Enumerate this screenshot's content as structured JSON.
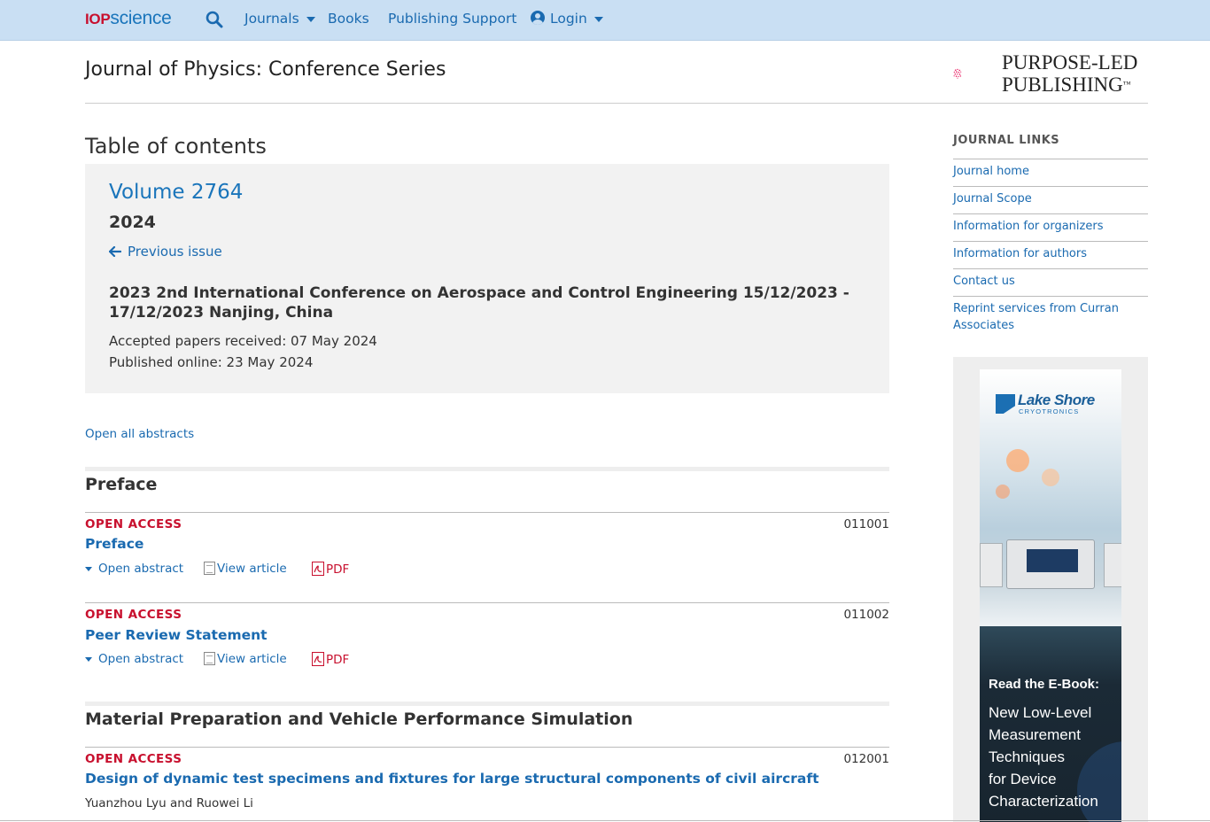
{
  "nav": {
    "logo_brand": "IOP",
    "logo_product": "science",
    "journals": "Journals",
    "books": "Books",
    "publishing_support": "Publishing Support",
    "login": "Login"
  },
  "header": {
    "journal_title": "Journal of Physics: Conference Series",
    "publisher_logo_line1": "PURPOSE-LED",
    "publisher_logo_line2": "PUBLISHING",
    "publisher_logo_tm": "™"
  },
  "toc": {
    "heading": "Table of contents",
    "volume": "Volume 2764",
    "year": "2024",
    "previous_issue": "Previous issue",
    "conference": "2023 2nd International Conference on Aerospace and Control Engineering 15/12/2023 - 17/12/2023 Nanjing, China",
    "accepted": "Accepted papers received: 07 May 2024",
    "published": "Published online: 23 May 2024",
    "open_all": "Open all abstracts"
  },
  "sections": [
    {
      "title": "Preface",
      "articles": [
        {
          "access": "OPEN ACCESS",
          "number": "011001",
          "title": "Preface",
          "open_abstract": "Open abstract",
          "view_article": "View article",
          "pdf": "PDF"
        },
        {
          "access": "OPEN ACCESS",
          "number": "011002",
          "title": "Peer Review Statement",
          "open_abstract": "Open abstract",
          "view_article": "View article",
          "pdf": "PDF"
        }
      ]
    },
    {
      "title": "Material Preparation and Vehicle Performance Simulation",
      "articles": [
        {
          "access": "OPEN ACCESS",
          "number": "012001",
          "title": "Design of dynamic test specimens and fixtures for large structural components of civil aircraft",
          "authors": "Yuanzhou Lyu and Ruowei Li"
        }
      ]
    }
  ],
  "sidebar": {
    "heading": "JOURNAL LINKS",
    "links": [
      "Journal home",
      "Journal Scope",
      "Information for organizers",
      "Information for authors",
      "Contact us",
      "Reprint services from Curran Associates"
    ]
  },
  "ad": {
    "brand": "Lake Shore",
    "brand_sub": "CRYOTRONICS",
    "cta": "Read the E-Book:",
    "lines": [
      "New Low-Level",
      "Measurement",
      "Techniques",
      "for Device",
      "Characterization"
    ]
  },
  "colors": {
    "nav_bg": "#c9dff3",
    "link": "#1a6ab0",
    "open_access": "#c8102e",
    "volume_box": "#f2f2f2"
  }
}
